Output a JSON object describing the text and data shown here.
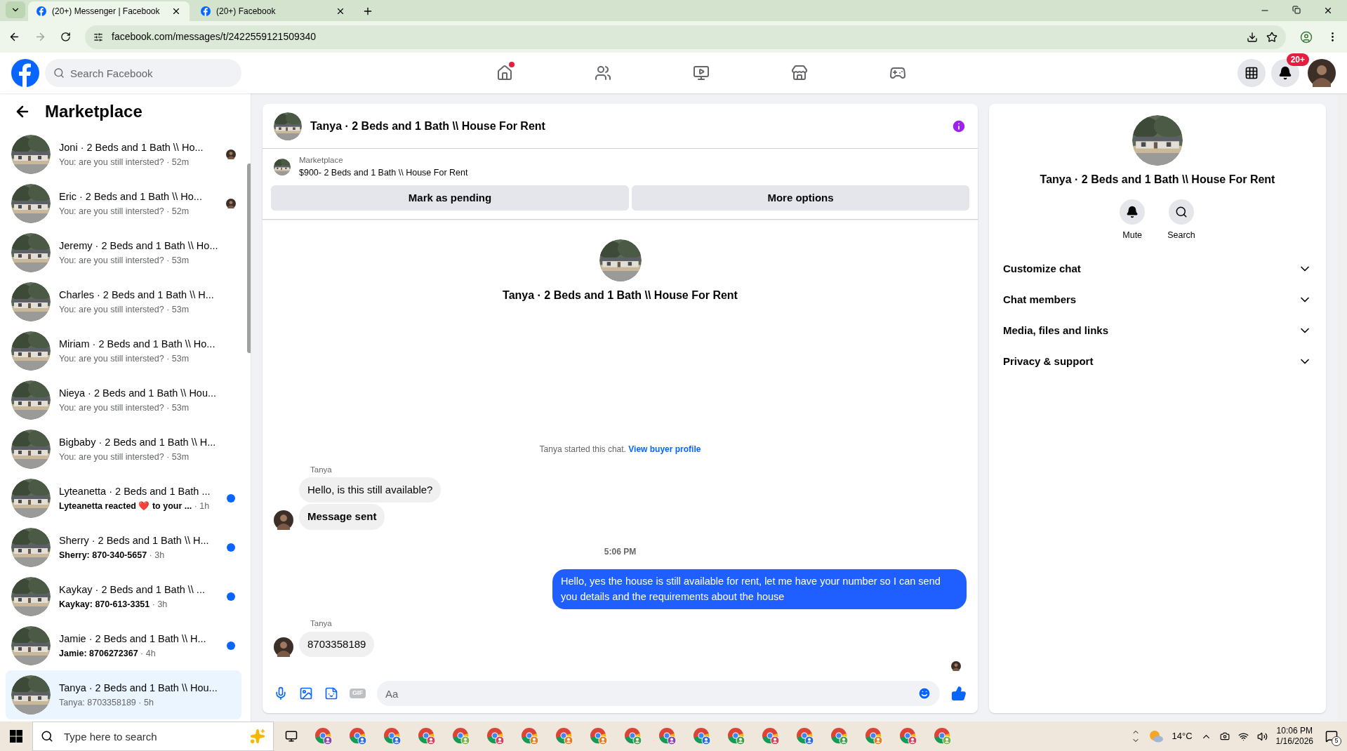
{
  "browser": {
    "tabs": [
      {
        "title": "(20+) Messenger | Facebook",
        "selected": true
      },
      {
        "title": "(20+) Facebook",
        "selected": false
      }
    ],
    "url": "facebook.com/messages/t/2422559121509340"
  },
  "header": {
    "search_placeholder": "Search Facebook",
    "nav": [
      {
        "kind": "home",
        "badge": true
      },
      {
        "kind": "friends",
        "badge": false
      },
      {
        "kind": "video",
        "badge": false
      },
      {
        "kind": "marketplace",
        "badge": false
      },
      {
        "kind": "gaming",
        "badge": false
      }
    ],
    "notification_count": "20+"
  },
  "sidebar": {
    "title": "Marketplace",
    "conversations": [
      {
        "title": "Joni · 2 Beds and 1 Bath \\\\ Ho...",
        "preview": "You: are you still intersted?",
        "time": "· 52m",
        "unread": false,
        "seen_avatar": true,
        "selected": false
      },
      {
        "title": "Eric · 2 Beds and 1 Bath \\\\ Ho...",
        "preview": "You: are you still intersted?",
        "time": "· 52m",
        "unread": false,
        "seen_avatar": true,
        "selected": false
      },
      {
        "title": "Jeremy · 2 Beds and 1 Bath \\\\ Ho...",
        "preview": "You: are you still intersted?",
        "time": "· 53m",
        "unread": false,
        "seen_avatar": false,
        "selected": false
      },
      {
        "title": "Charles · 2 Beds and 1 Bath \\\\ H...",
        "preview": "You: are you still intersted?",
        "time": "· 53m",
        "unread": false,
        "seen_avatar": false,
        "selected": false
      },
      {
        "title": "Miriam · 2 Beds and 1 Bath \\\\ Ho...",
        "preview": "You: are you still intersted?",
        "time": "· 53m",
        "unread": false,
        "seen_avatar": false,
        "selected": false
      },
      {
        "title": "Nieya · 2 Beds and 1 Bath \\\\ Hou...",
        "preview": "You: are you still intersted?",
        "time": "· 53m",
        "unread": false,
        "seen_avatar": false,
        "selected": false
      },
      {
        "title": "Bigbaby · 2 Beds and 1 Bath \\\\ H...",
        "preview": "You: are you still intersted?",
        "time": "· 53m",
        "unread": false,
        "seen_avatar": false,
        "selected": false
      },
      {
        "title": "Lyteanetta · 2 Beds and 1 Bath ...",
        "preview": "Lyteanetta reacted ❤️ to your ...",
        "time": "· 1h",
        "unread": true,
        "seen_avatar": false,
        "selected": false
      },
      {
        "title": "Sherry · 2 Beds and 1 Bath \\\\ H...",
        "preview": "Sherry: 870-340-5657",
        "time": "· 3h",
        "unread": true,
        "seen_avatar": false,
        "selected": false
      },
      {
        "title": "Kaykay · 2 Beds and 1 Bath \\\\ ...",
        "preview": "Kaykay: 870-613-3351",
        "time": "· 3h",
        "unread": true,
        "seen_avatar": false,
        "selected": false
      },
      {
        "title": "Jamie · 2 Beds and 1 Bath \\\\ H...",
        "preview": "Jamie: 8706272367",
        "time": "· 4h",
        "unread": true,
        "seen_avatar": false,
        "selected": false
      },
      {
        "title": "Tanya · 2 Beds and 1 Bath \\\\ Hou...",
        "preview": "Tanya: 8703358189",
        "time": "· 5h",
        "unread": false,
        "seen_avatar": false,
        "selected": true
      }
    ]
  },
  "chat": {
    "title": "Tanya · 2 Beds and 1 Bath \\\\ House For Rent",
    "listing": {
      "label": "Marketplace",
      "name": "$900- 2 Beds and 1 Bath \\\\ House For Rent",
      "buttons": [
        "Mark as pending",
        "More options"
      ]
    },
    "profile_title": "Tanya · 2 Beds and 1 Bath \\\\ House For Rent",
    "conversation": [
      {
        "kind": "system",
        "text": "Tanya started this chat.",
        "link": "View buyer profile"
      },
      {
        "kind": "incoming",
        "sender": "Tanya",
        "bubbles": [
          {
            "text": "Hello, is this still available?",
            "bold": false
          },
          {
            "text": "Message sent",
            "bold": true
          }
        ]
      },
      {
        "kind": "time",
        "text": "5:06 PM"
      },
      {
        "kind": "outgoing",
        "bubbles": [
          {
            "text": "Hello, yes the house is still available for rent, let me have your number so I can send you details and the requirements about the house",
            "bold": false
          }
        ]
      },
      {
        "kind": "incoming",
        "sender": "Tanya",
        "bubbles": [
          {
            "text": "8703358189",
            "bold": false
          }
        ]
      }
    ],
    "read_receipt": true,
    "composer": {
      "gif_label": "GIF",
      "placeholder": "Aa"
    }
  },
  "details": {
    "title": "Tanya · 2 Beds and 1 Bath \\\\ House For Rent",
    "actions": [
      {
        "kind": "mute",
        "label": "Mute"
      },
      {
        "kind": "search",
        "label": "Search"
      }
    ],
    "sections": [
      {
        "label": "Customize chat",
        "expanded": false
      },
      {
        "label": "Chat members",
        "expanded": false
      },
      {
        "label": "Media, files and links",
        "expanded": false
      },
      {
        "label": "Privacy & support",
        "expanded": false
      }
    ]
  },
  "taskbar": {
    "search_placeholder": "Type here to search",
    "temperature": "14°C",
    "time": "10:06 PM",
    "date": "1/16/2026",
    "notification_count": "5"
  }
}
